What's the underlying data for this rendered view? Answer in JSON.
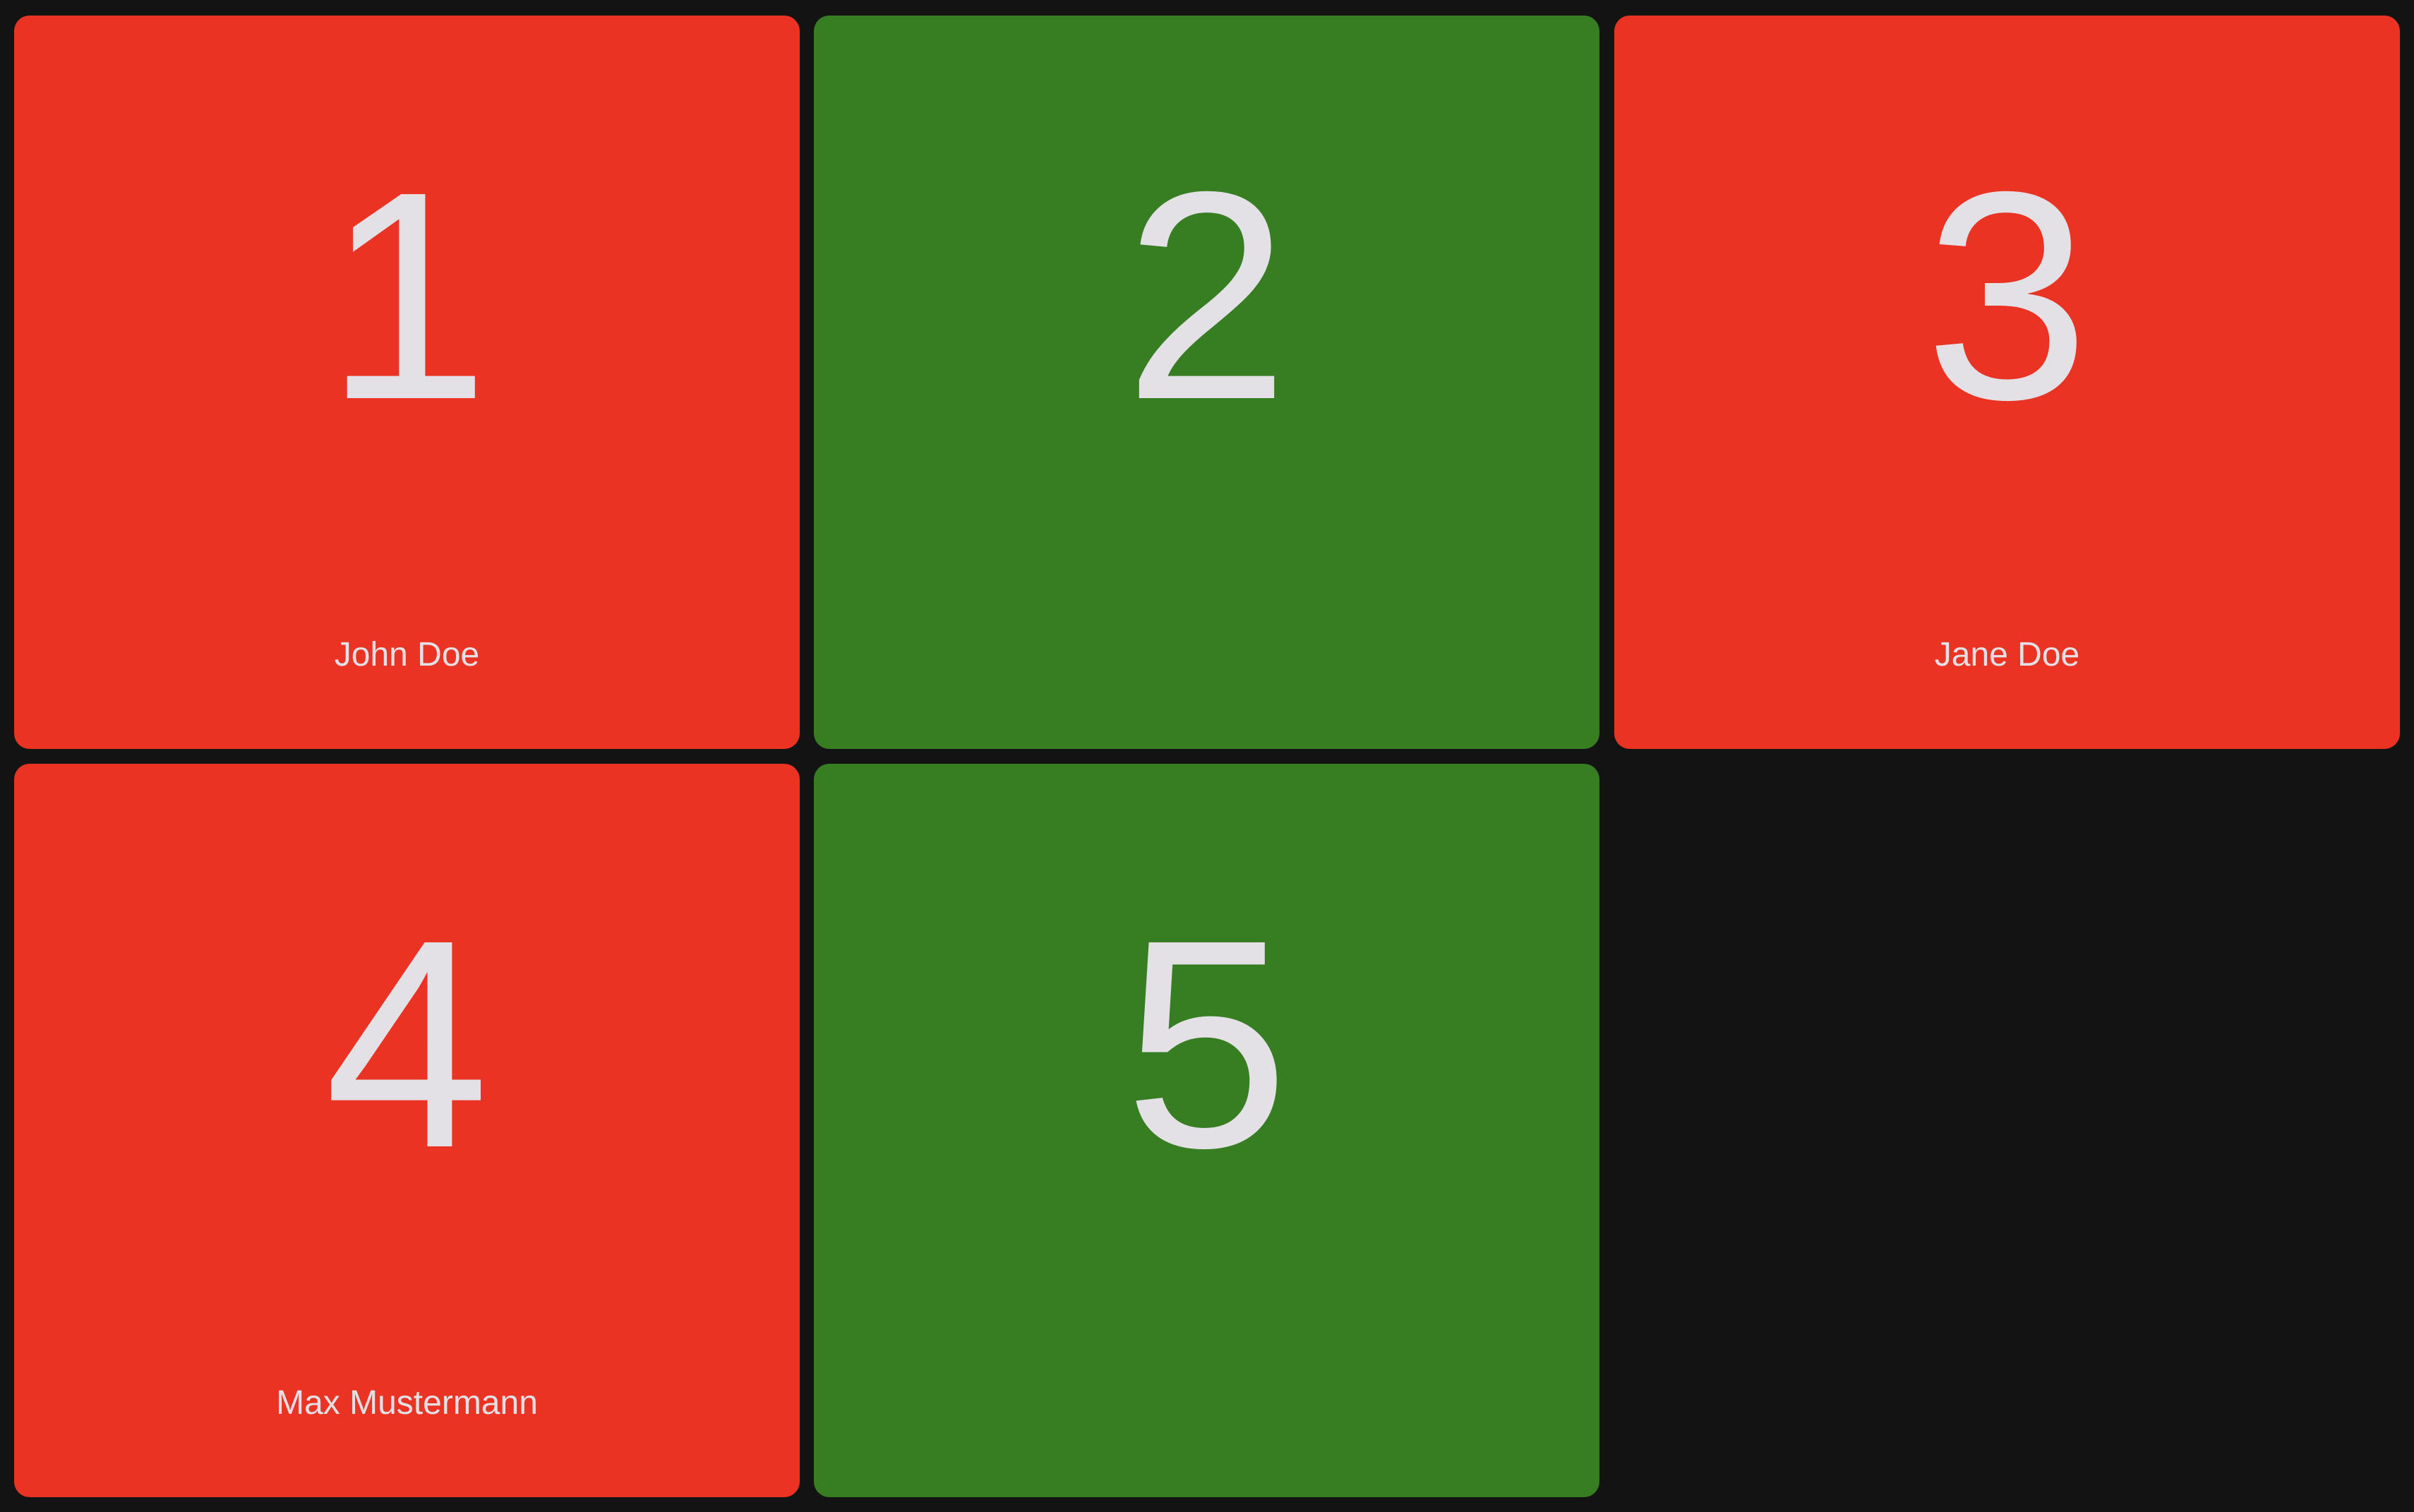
{
  "colors": {
    "background": "#131314",
    "occupied": "#ea3323",
    "free": "#377e22",
    "text": "#e3e1e6"
  },
  "tiles": [
    {
      "number": "1",
      "name": "John Doe",
      "status": "occupied"
    },
    {
      "number": "2",
      "name": "",
      "status": "free"
    },
    {
      "number": "3",
      "name": "Jane Doe",
      "status": "occupied"
    },
    {
      "number": "4",
      "name": "Max Mustermann",
      "status": "occupied"
    },
    {
      "number": "5",
      "name": "",
      "status": "free"
    }
  ]
}
